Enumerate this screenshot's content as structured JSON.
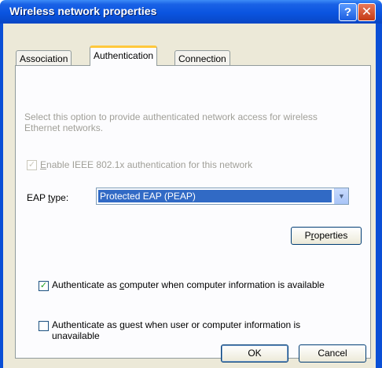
{
  "window": {
    "title": "Wireless network properties"
  },
  "titlebar": {
    "help_glyph": "?",
    "close_glyph": "✕"
  },
  "tabs": [
    {
      "label": "Association",
      "active": false
    },
    {
      "label": "Authentication",
      "active": true
    },
    {
      "label": "Connection",
      "active": false
    }
  ],
  "panel": {
    "description": "Select this option to provide authenticated network access for wireless Ethernet networks.",
    "enable_8021x": {
      "pre": "",
      "key": "E",
      "post": "nable IEEE 802.1x authentication for this network",
      "checked": true,
      "disabled": true
    },
    "eap_label": {
      "pre": "EAP ",
      "key": "t",
      "post": "ype:"
    },
    "eap_type": {
      "value": "Protected EAP (PEAP)"
    },
    "properties_button": {
      "pre": "P",
      "key": "r",
      "post": "operties"
    },
    "auth_computer": {
      "pre": "Authenticate as ",
      "key": "c",
      "post": "omputer when computer information is available",
      "checked": true
    },
    "auth_guest": {
      "line1_pre": "Authenticate as ",
      "line1_key": "g",
      "line1_post": "uest when user or computer information is",
      "line2": "unavailable",
      "checked": false
    }
  },
  "footer": {
    "ok_label": "OK",
    "cancel_label": "Cancel"
  },
  "colors": {
    "titlebar": "#0a54e0",
    "dialog_bg": "#ece9d8",
    "selection": "#316ac5",
    "checkmark": "#21a121"
  }
}
